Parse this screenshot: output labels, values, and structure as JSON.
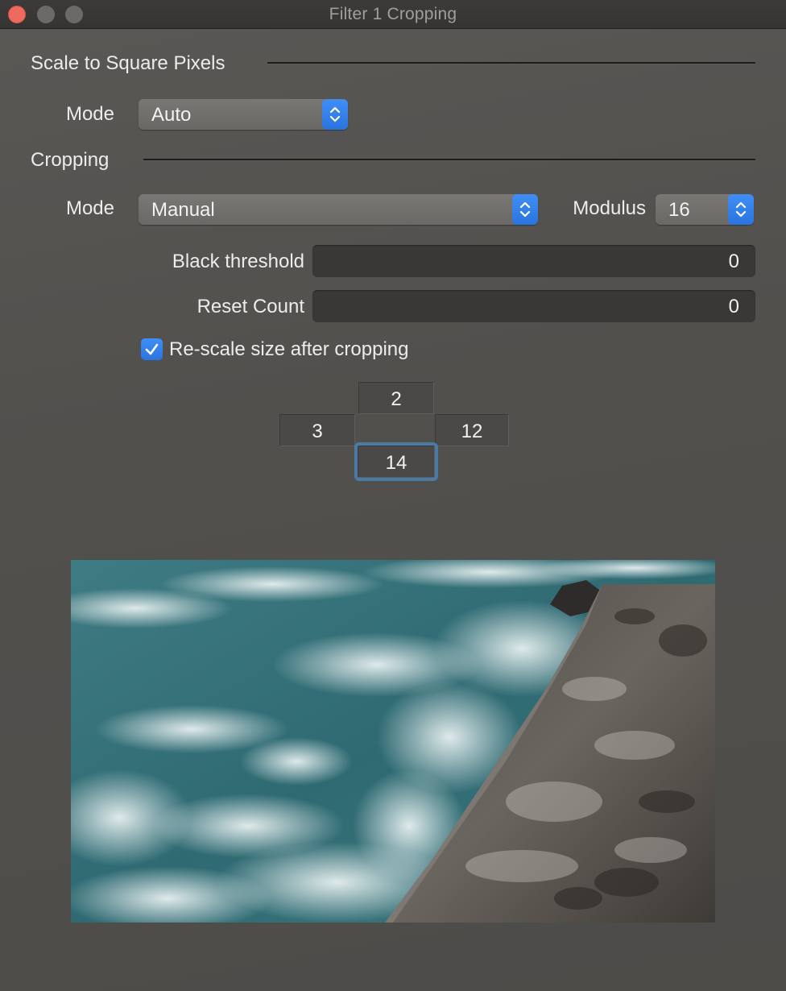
{
  "window": {
    "title": "Filter 1 Cropping"
  },
  "scale_section": {
    "title": "Scale to Square Pixels",
    "mode_label": "Mode",
    "mode_value": "Auto"
  },
  "cropping_section": {
    "title": "Cropping",
    "mode_label": "Mode",
    "mode_value": "Manual",
    "modulus_label": "Modulus",
    "modulus_value": "16",
    "black_threshold_label": "Black threshold",
    "black_threshold_value": "0",
    "reset_count_label": "Reset Count",
    "reset_count_value": "0",
    "rescale_label": "Re-scale size after cropping",
    "rescale_checked": true
  },
  "crop_values": {
    "top": "2",
    "left": "3",
    "right": "12",
    "bottom": "14"
  },
  "colors": {
    "accent": "#2f7ef0",
    "close_button": "#ed6a5e",
    "focus_ring": "#4a7aa6"
  }
}
